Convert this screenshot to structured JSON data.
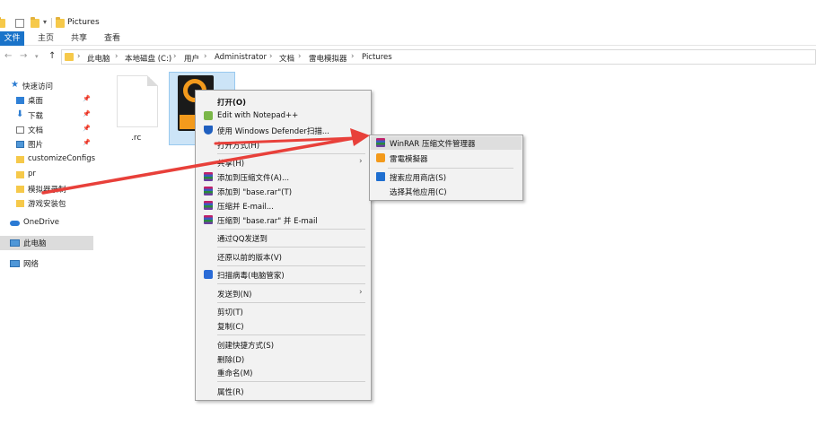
{
  "window": {
    "title": "Pictures"
  },
  "ribbon": {
    "tabs": [
      {
        "label": "文件"
      },
      {
        "label": "主页"
      },
      {
        "label": "共享"
      },
      {
        "label": "查看"
      }
    ]
  },
  "address": {
    "crumbs": [
      {
        "label": "此电脑"
      },
      {
        "label": "本地磁盘 (C:)"
      },
      {
        "label": "用户"
      },
      {
        "label": "Administrator"
      },
      {
        "label": "文档"
      },
      {
        "label": "雷电模拟器"
      },
      {
        "label": "Pictures"
      }
    ],
    "separator": "›"
  },
  "sidebar": {
    "items": [
      {
        "label": "快速访问"
      },
      {
        "label": "桌面"
      },
      {
        "label": "下载"
      },
      {
        "label": "文档"
      },
      {
        "label": "图片"
      },
      {
        "label": "customizeConfigs"
      },
      {
        "label": "pr"
      },
      {
        "label": "模拟器录制"
      },
      {
        "label": "游戏安装包"
      },
      {
        "label": "OneDrive"
      },
      {
        "label": "此电脑"
      },
      {
        "label": "网络"
      }
    ]
  },
  "files": [
    {
      "name": ".rc"
    }
  ],
  "context_menu": {
    "items": [
      {
        "label": "打开(O)"
      },
      {
        "label": "Edit with Notepad++"
      },
      {
        "label": "使用 Windows Defender扫描..."
      },
      {
        "label": "打开方式(H)"
      },
      {
        "label": "共享(H)"
      },
      {
        "label": "添加到压缩文件(A)..."
      },
      {
        "label": "添加到 \"base.rar\"(T)"
      },
      {
        "label": "压缩并 E-mail..."
      },
      {
        "label": "压缩到 \"base.rar\" 并 E-mail"
      },
      {
        "label": "通过QQ发送到"
      },
      {
        "label": "还原以前的版本(V)"
      },
      {
        "label": "扫描病毒(电脑管家)"
      },
      {
        "label": "发送到(N)"
      },
      {
        "label": "剪切(T)"
      },
      {
        "label": "复制(C)"
      },
      {
        "label": "创建快捷方式(S)"
      },
      {
        "label": "删除(D)"
      },
      {
        "label": "重命名(M)"
      },
      {
        "label": "属性(R)"
      }
    ]
  },
  "submenu": {
    "items": [
      {
        "label": "WinRAR 压缩文件管理器"
      },
      {
        "label": "雷電模擬器"
      },
      {
        "label": "搜索应用商店(S)"
      },
      {
        "label": "选择其他应用(C)"
      }
    ]
  },
  "colors": {
    "accent": "#1a73c9",
    "annotation_arrow": "#e8403a",
    "selection": "#cce4f7"
  }
}
